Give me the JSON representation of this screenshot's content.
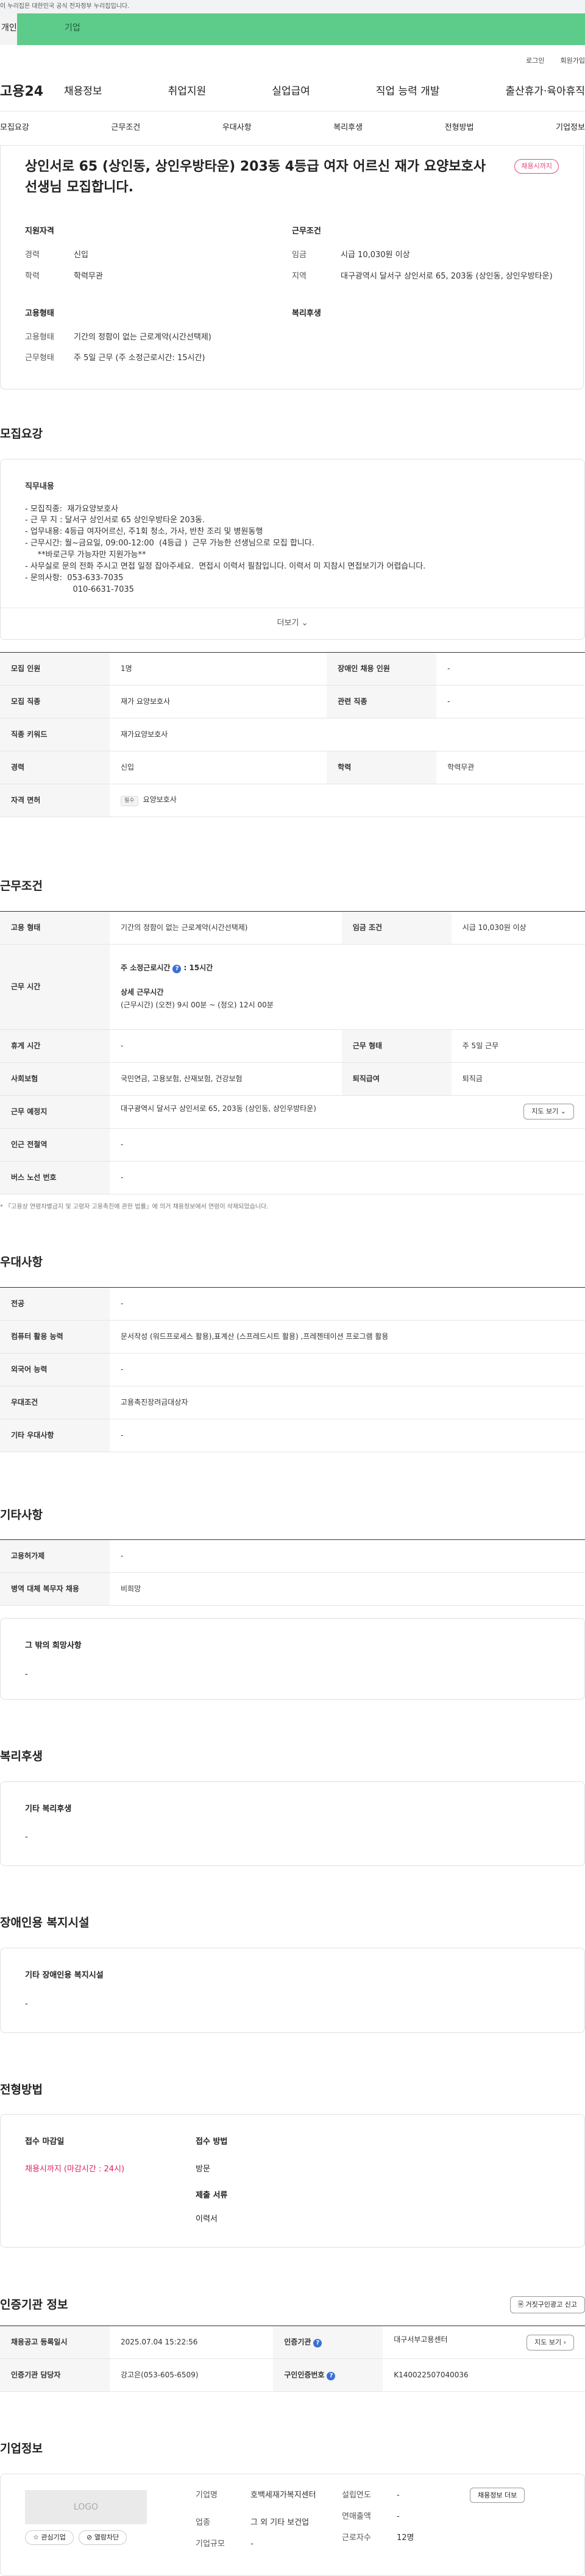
{
  "gov_banner": "이 누리집은 대한민국 공식 전자정부 누리집입니다.",
  "top_tabs": {
    "personal": "개인",
    "company": "기업"
  },
  "util": {
    "login": "로그인",
    "join": "회원가입"
  },
  "gnb": {
    "logo": "고용24",
    "items": [
      "채용정보",
      "취업지원",
      "실업급여",
      "직업 능력 개발",
      "출산휴가·육아휴직"
    ]
  },
  "subnav": [
    "모집요강",
    "근무조건",
    "우대사항",
    "복리후생",
    "전형방법",
    "기업정보"
  ],
  "header": {
    "title": "상인서로 65 (상인동, 상인우방타운) 203동 4등급 여자 어르신 재가 요양보호사 선생님 모집합니다.",
    "badge": "채용시까지",
    "qual_title": "지원자격",
    "qual": [
      {
        "k": "경력",
        "v": "신입"
      },
      {
        "k": "학력",
        "v": "학력무관"
      }
    ],
    "cond_title": "근무조건",
    "cond": [
      {
        "k": "임금",
        "v": "시급 10,030원 이상"
      },
      {
        "k": "지역",
        "v": "대구광역시 달서구 상인서로 65, 203동 (상인동, 상인우방타운)"
      }
    ],
    "type_title": "고용형태",
    "type": [
      {
        "k": "고용형태",
        "v": "기간의 정함이 없는 근로계약(시간선택제)"
      },
      {
        "k": "근무형태",
        "v": "주 5일 근무 (주 소정근로시간: 15시간)"
      }
    ],
    "welfare_title": "복리후생"
  },
  "recruit": {
    "title": "모집요강",
    "detail_title": "직무내용",
    "detail_body": "- 모집직종:  재가요양보호사\n- 근 무 지 : 달서구 상인서로 65 상인우방타운 203동.\n- 업무내용: 4등급 여자어르신, 주1회 청소, 가사, 반찬 조리 및 병원동행\n- 근무시간: 월~금요일, 09:00-12:00  (4등급 )  근무 가능한 선생님으로 모집 합니다.\n     **바로근무 가능자만 지원가능**\n- 사무실로 문의 전화 주시고 면접 일정 잡아주세요.  면접시 이력서 필참입니다. 이력서 미 지참시 면접보기가 어렵습니다.\n- 문의사항:  053-633-7035\n                   010-6631-7035",
    "more": "더보기",
    "table": {
      "count_k": "모집 인원",
      "count_v": "1명",
      "disabled_k": "장애인 채용 인원",
      "disabled_v": "-",
      "job_k": "모집 직종",
      "job_v": "재가 요양보호사",
      "related_k": "관련 직종",
      "related_v": "-",
      "keyword_k": "직종 키워드",
      "keyword_v": "재가요양보호사",
      "career_k": "경력",
      "career_v": "신입",
      "edu_k": "학력",
      "edu_v": "학력무관",
      "license_k": "자격 면허",
      "license_tag": "필수",
      "license_v": "요양보호사"
    }
  },
  "conditions": {
    "title": "근무조건",
    "emp_k": "고용 형태",
    "emp_v": "기간의 정함이 없는 근로계약(시간선택제)",
    "wage_k": "임금 조건",
    "wage_v": "시급 10,030원 이상",
    "time_k": "근무 시간",
    "time_week_label": "주 소정근로시간",
    "time_week_v": ": 15시간",
    "time_detail_label": "상세 근무시간",
    "time_detail_v": "(근무시간) (오전) 9시 00분 ~ (정오) 12시 00분",
    "rest_k": "휴게 시간",
    "rest_v": "-",
    "form_k": "근무 형태",
    "form_v": "주 5일 근무",
    "ins_k": "사회보험",
    "ins_v": "국민연금, 고용보험, 산재보험, 건강보험",
    "sev_k": "퇴직급여",
    "sev_v": "퇴직금",
    "place_k": "근무 예정지",
    "place_v": "대구광역시 달서구 상인서로 65, 203동 (상인동, 상인우방타운)",
    "map_btn": "지도 보기",
    "subway_k": "인근 전철역",
    "subway_v": "-",
    "bus_k": "버스 노선 번호",
    "bus_v": "-",
    "note": "* 『고용상 연령차별금지 및 고령자 고용촉진에 관한 법률』에 의거 채용정보에서 연령이 삭제되었습니다."
  },
  "prefer": {
    "title": "우대사항",
    "major_k": "전공",
    "major_v": "-",
    "pc_k": "컴퓨터 활용 능력",
    "pc_v": "문서작성 (워드프로세스 활용),표계산 (스프레드시트 활용) ,프레젠테이션 프로그램 활용",
    "lang_k": "외국어 능력",
    "lang_v": "-",
    "cond_k": "우대조건",
    "cond_v": "고용촉진장려금대상자",
    "etc_k": "기타 우대사항",
    "etc_v": "-"
  },
  "etc": {
    "title": "기타사항",
    "support_k": "고용허가제",
    "support_v": "-",
    "military_k": "병역 대체 복무자 채용",
    "military_v": "비희망",
    "hope_title": "그 밖의 희망사항",
    "hope_v": "-"
  },
  "welfare": {
    "title": "복리후생",
    "box_title": "기타 복리후생",
    "box_v": "-"
  },
  "disabled": {
    "title": "장애인용 복지시설",
    "box_title": "기타 장애인용 복지시설",
    "box_v": "-"
  },
  "process": {
    "title": "전형방법",
    "deadline_title": "접수 마감일",
    "deadline_v": "채용시까지 (마감시간 : 24시)",
    "method_title": "접수 방법",
    "method_v": "방문",
    "docs_title": "제출 서류",
    "docs_v": "이력서"
  },
  "cert": {
    "title": "인증기관 정보",
    "report_btn": "거짓구인광고 신고",
    "date_k": "채용공고 등록일시",
    "date_v": "2025.07.04 15:22:56",
    "org_k": "인증기관",
    "org_v": "대구서부고용센터",
    "map_btn": "지도 보기",
    "mgr_k": "인증기관 담당자",
    "mgr_v": "강고은(053-605-6509)",
    "no_k": "구인인증번호",
    "no_v": "K140022507040036"
  },
  "company": {
    "title": "기업정보",
    "logo": "LOGO",
    "fav_btn": "관심기업",
    "block_btn": "열람차단",
    "name_k": "기업명",
    "name_v": "호백세재가복지센터",
    "industry_k": "업종",
    "industry_v": "그 외 기타 보건업",
    "size_k": "기업규모",
    "size_v": "-",
    "year_k": "설립연도",
    "year_v": "-",
    "sales_k": "연매출액",
    "sales_v": "-",
    "emp_k": "근로자수",
    "emp_v": "12명",
    "jobs_btn": "채용정보 더보"
  }
}
